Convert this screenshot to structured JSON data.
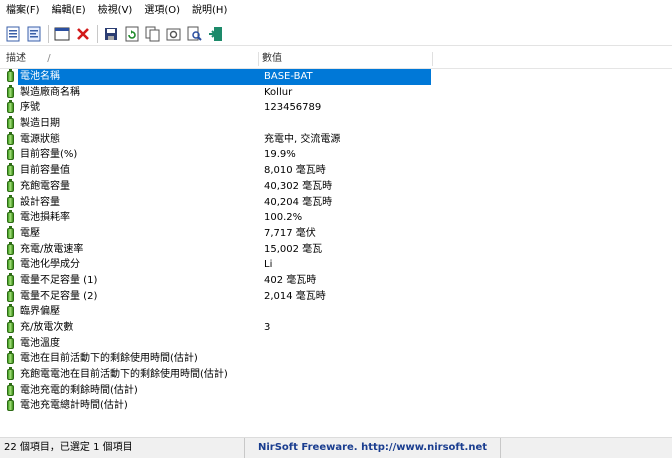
{
  "menubar": {
    "items": [
      "檔案(F)",
      "編輯(E)",
      "檢視(V)",
      "選項(O)",
      "說明(H)"
    ]
  },
  "toolbar": {
    "buttons": [
      "html-report-icon",
      "text-report-icon",
      "properties-icon",
      "delete-icon",
      "save-icon",
      "refresh-icon",
      "copy-icon",
      "options-icon",
      "find-icon",
      "exit-icon"
    ]
  },
  "columns": {
    "desc": "描述",
    "desc_sort": "/",
    "value": "數值"
  },
  "rows": [
    {
      "desc": "電池名稱",
      "value": "BASE-BAT",
      "selected": true
    },
    {
      "desc": "製造廠商名稱",
      "value": "Kollur"
    },
    {
      "desc": "序號",
      "value": "123456789"
    },
    {
      "desc": "製造日期",
      "value": ""
    },
    {
      "desc": "電源狀態",
      "value": "充電中, 交流電源"
    },
    {
      "desc": "目前容量(%)",
      "value": "19.9%"
    },
    {
      "desc": "目前容量值",
      "value": "8,010 毫瓦時"
    },
    {
      "desc": "充飽電容量",
      "value": "40,302 毫瓦時"
    },
    {
      "desc": "設計容量",
      "value": "40,204 毫瓦時"
    },
    {
      "desc": "電池損耗率",
      "value": "100.2%"
    },
    {
      "desc": "電壓",
      "value": "7,717 毫伏"
    },
    {
      "desc": "充電/放電速率",
      "value": "15,002 毫瓦"
    },
    {
      "desc": "電池化學成分",
      "value": "Li"
    },
    {
      "desc": "電量不足容量 (1)",
      "value": "402 毫瓦時"
    },
    {
      "desc": "電量不足容量 (2)",
      "value": "2,014 毫瓦時"
    },
    {
      "desc": "臨界偏壓",
      "value": ""
    },
    {
      "desc": "充/放電次數",
      "value": "3"
    },
    {
      "desc": "電池溫度",
      "value": ""
    },
    {
      "desc": "電池在目前活動下的剩餘使用時間(估計)",
      "value": ""
    },
    {
      "desc": "充飽電電池在目前活動下的剩餘使用時間(估計)",
      "value": ""
    },
    {
      "desc": "電池充電的剩餘時間(估計)",
      "value": ""
    },
    {
      "desc": "電池充電總計時間(估計)",
      "value": ""
    }
  ],
  "statusbar": {
    "items_text": "22 個項目，已選定 1 個項目",
    "credit": "NirSoft Freeware.  http://www.nirsoft.net"
  },
  "colors": {
    "selection": "#0078d7",
    "battery_green": "#3e9a1d",
    "credit_blue": "#1a3d8f"
  }
}
